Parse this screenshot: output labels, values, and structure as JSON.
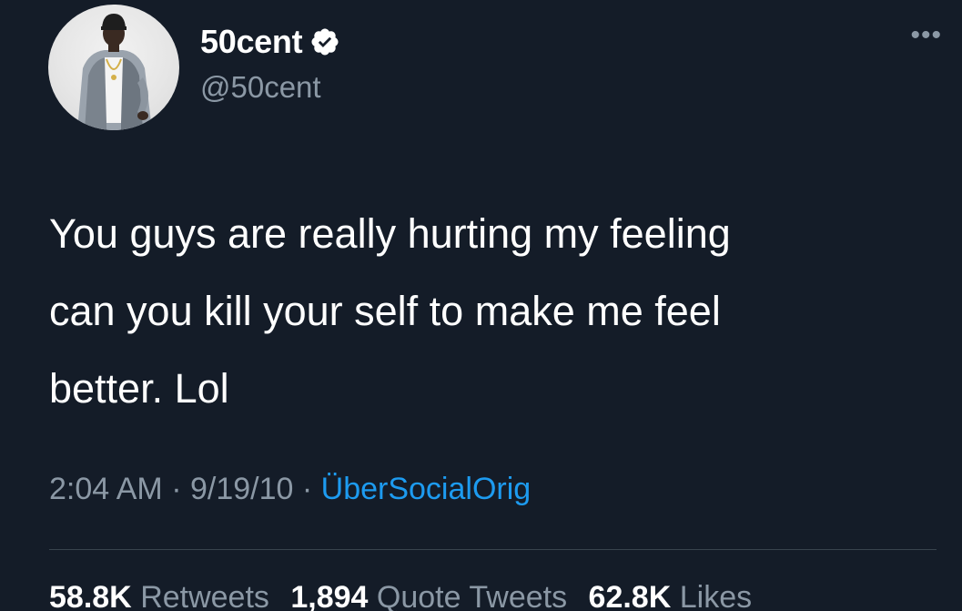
{
  "user": {
    "display_name": "50cent",
    "handle": "@50cent"
  },
  "tweet": {
    "text": "You guys are really hurting my feeling\ncan you kill your self to make me feel\nbetter. Lol",
    "time": "2:04 AM",
    "date": "9/19/10",
    "separator": " · ",
    "source": "ÜberSocialOrig"
  },
  "stats": {
    "retweets_count": "58.8K",
    "retweets_label": "Retweets",
    "quotes_count": "1,894",
    "quotes_label": "Quote Tweets",
    "likes_count": "62.8K",
    "likes_label": "Likes"
  },
  "icons": {
    "verified": "verified-badge-icon",
    "more": "more-options-icon"
  },
  "colors": {
    "background": "#141c28",
    "text": "#ffffff",
    "secondary": "#8b98a5",
    "link": "#1d9bf0"
  }
}
